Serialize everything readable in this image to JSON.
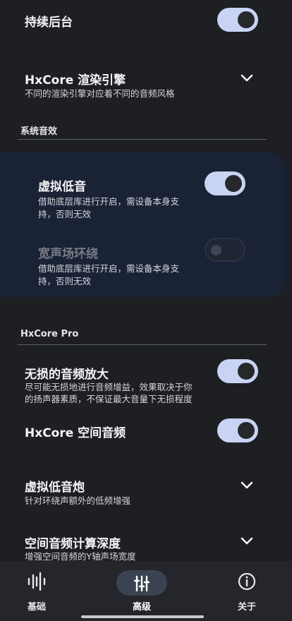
{
  "rows": {
    "keep_background": {
      "title": "持续后台",
      "enabled": true
    },
    "hxcore_engine": {
      "title": "HxCore 渲染引擎",
      "desc": "不同的渲染引擎对应着不同的音频风格"
    },
    "system_audio_label": "系统音效",
    "virtual_bass": {
      "title": "虚拟低音",
      "desc_line1": "借助底层库进行开启，需设备本身支",
      "desc_line2": "持，否则无效",
      "enabled": true
    },
    "wide_stage": {
      "title": "宽声场环绕",
      "desc_line1": "借助底层库进行开启，需设备本身支",
      "desc_line2": "持，否则无效",
      "enabled": false
    },
    "hxcore_pro_label": "HxCore Pro",
    "lossless_amp": {
      "title": "无损的音频放大",
      "desc_line1": "尽可能无损地进行音频增益，效果取决于你",
      "desc_line2": "的扬声器素质，不保证最大音量下无损程度",
      "enabled": true
    },
    "spatial_audio": {
      "title": "HxCore 空间音频",
      "enabled": true
    },
    "virtual_subwoofer": {
      "title": "虚拟低音炮",
      "desc": "针对环绕声额外的低频增强"
    },
    "spatial_depth": {
      "title": "空间音频计算深度",
      "desc": "增强空间音频的Y轴声场宽度"
    }
  },
  "nav": {
    "basic": {
      "label": "基础",
      "icon": "equalizer-bars-icon"
    },
    "advanced": {
      "label": "高级",
      "icon": "sliders-icon",
      "selected": true
    },
    "about": {
      "label": "关于",
      "icon": "info-icon"
    }
  },
  "colors": {
    "background": "#1d1f23",
    "toggle_on": "#c9d3f3",
    "card": "#1a2236",
    "nav_bg": "#24262b",
    "nav_pill": "#3b4251"
  }
}
